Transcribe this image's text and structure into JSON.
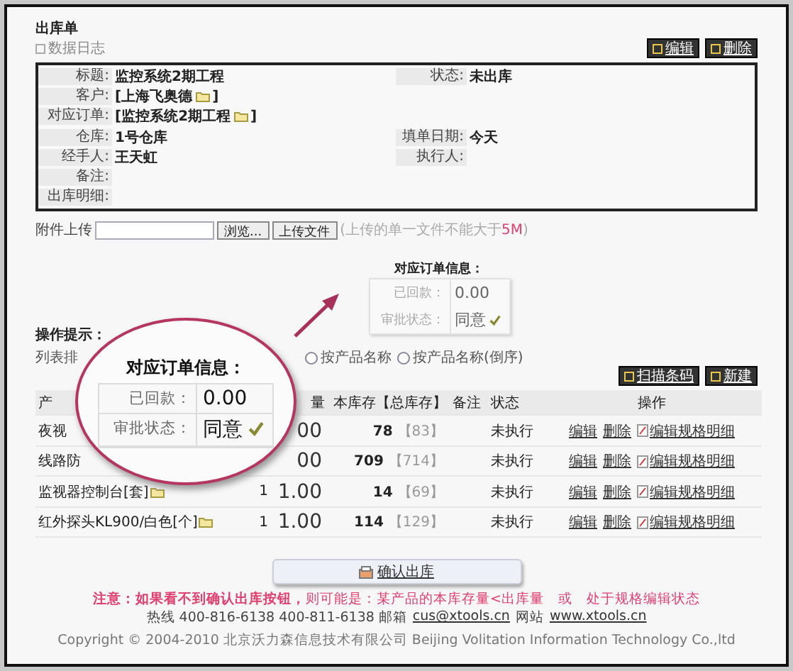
{
  "header": {
    "title": "出库单",
    "log_link": "数据日志",
    "buttons": [
      "编辑",
      "删除"
    ]
  },
  "info": {
    "rows": [
      {
        "cells": [
          {
            "label": "标题:",
            "value": "监控系统2期工程",
            "kind": "text"
          },
          {
            "label": "状态:",
            "value": "未出库",
            "kind": "text"
          }
        ]
      },
      {
        "cells": [
          {
            "label": "客户:",
            "value": "[上海飞奥德",
            "after": "]",
            "kind": "link"
          }
        ]
      },
      {
        "cells": [
          {
            "label": "对应订单:",
            "value": "[监控系统2期工程",
            "after": "]",
            "kind": "link"
          }
        ]
      },
      {
        "cells": [
          {
            "label": "仓库:",
            "value": "1号仓库",
            "kind": "text"
          },
          {
            "label": "填单日期:",
            "value": "今天",
            "kind": "text"
          }
        ]
      },
      {
        "cells": [
          {
            "label": "经手人:",
            "value": "王天虹",
            "kind": "text"
          },
          {
            "label": "执行人:"
          }
        ]
      },
      {
        "cells": [
          {
            "label": "备注:"
          }
        ]
      },
      {
        "cells": [
          {
            "label": "出库明细:"
          }
        ]
      }
    ]
  },
  "attachment": {
    "label": "附件上传",
    "browse": "浏览...",
    "upload": "上传文件",
    "note": "(上传的单一文件不能大于",
    "note_size": "5M",
    "note_end": ")"
  },
  "order_info": {
    "title": "对应订单信息：",
    "rows": [
      {
        "label": "已回款：",
        "value": "0.00"
      },
      {
        "label": "审批状态：",
        "value": "同意",
        "approved": true
      }
    ]
  },
  "hint": "操作提示：",
  "sort": {
    "label": "列表排",
    "options": [
      {
        "label": "按产品名称",
        "selected": false
      },
      {
        "label": "按产品名称(倒序)",
        "selected": false
      }
    ]
  },
  "toolbar": [
    "扫描条码",
    "新建"
  ],
  "table": {
    "columns": [
      "产",
      "量",
      "本库存【总库存】",
      "备注",
      "状态",
      "操作"
    ],
    "rows": [
      {
        "name": "夜视",
        "folder": false,
        "amount": "00",
        "stock": "78",
        "total": "【83】",
        "status": "未执行",
        "actions": [
          "编辑",
          "删除",
          "编辑规格明细"
        ]
      },
      {
        "name": "线路防",
        "folder": false,
        "amount": "00",
        "stock": "709",
        "total": "【714】",
        "status": "未执行",
        "actions": [
          "编辑",
          "删除",
          "编辑规格明细"
        ]
      },
      {
        "name": "监视器控制台[套]",
        "folder": true,
        "qty": "1",
        "amount": "1.00",
        "stock": "14",
        "total": "【69】",
        "status": "未执行",
        "actions": [
          "编辑",
          "删除",
          "编辑规格明细"
        ]
      },
      {
        "name": "红外探头KL900/白色[个]",
        "folder": true,
        "qty": "1",
        "amount": "1.00",
        "stock": "114",
        "total": "【129】",
        "status": "未执行",
        "actions": [
          "编辑",
          "删除",
          "编辑规格明细"
        ]
      }
    ]
  },
  "callout": {
    "title": "对应订单信息：",
    "rows": [
      {
        "label": "已回款：",
        "value": "0.00"
      },
      {
        "label": "审批状态：",
        "value": "同意",
        "approved": true
      }
    ]
  },
  "confirm": "确认出库",
  "warning": "**注意：如果看不到确认出库按钮，**则可能是：某产品的本库存量<出库量　或　处于规格编辑状态",
  "footer": {
    "hotline": "热线 400-816-6138  400-811-6138  邮箱",
    "email": "cus@xtools.cn",
    "site_label": "网站",
    "site": "www.xtools.cn",
    "copyright": "Copyright © 2004-2010  北京沃力森信息技术有限公司   Beijing Volitation Information Technology Co.,ltd"
  }
}
